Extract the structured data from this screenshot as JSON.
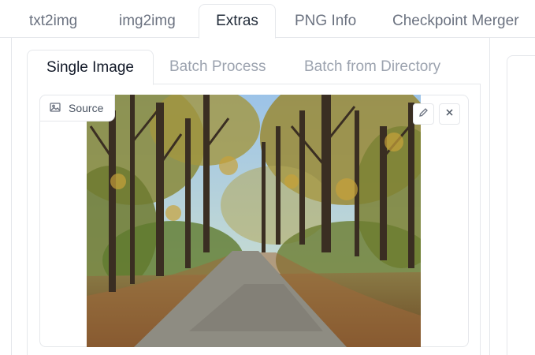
{
  "top_tabs": [
    {
      "label": "txt2img",
      "active": false
    },
    {
      "label": "img2img",
      "active": false
    },
    {
      "label": "Extras",
      "active": true
    },
    {
      "label": "PNG Info",
      "active": false
    },
    {
      "label": "Checkpoint Merger",
      "active": false
    }
  ],
  "sub_tabs": [
    {
      "label": "Single Image",
      "active": true
    },
    {
      "label": "Batch Process",
      "active": false
    },
    {
      "label": "Batch from Directory",
      "active": false
    }
  ],
  "image_panel": {
    "label": "Source",
    "label_icon": "image-icon",
    "edit_icon": "pencil-icon",
    "clear_icon": "close-icon"
  },
  "colors": {
    "border": "#e5e7eb",
    "active_text": "#1f2937",
    "inactive_text": "#6b7280"
  }
}
